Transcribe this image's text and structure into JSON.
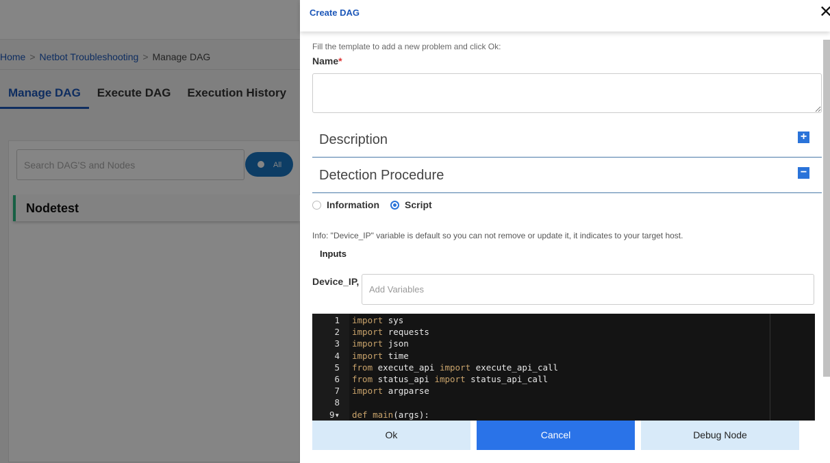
{
  "background": {
    "breadcrumb": [
      "Home",
      "Netbot Troubleshooting",
      "Manage DAG"
    ],
    "tabs": [
      "Manage DAG",
      "Execute DAG",
      "Execution History"
    ],
    "search_placeholder": "Search DAG'S and Nodes",
    "toggle_label": "All",
    "node_name": "Nodetest"
  },
  "dialog": {
    "title": "Create DAG",
    "hint": "Fill the template to add a new problem and click Ok:",
    "name_label": "Name",
    "name_value": "",
    "required_mark": "*",
    "sections": [
      {
        "label": "Description",
        "state": "collapsed",
        "icon": "+"
      },
      {
        "label": "Detection Procedure",
        "state": "expanded",
        "icon": "−"
      }
    ],
    "radio_options": [
      {
        "label": "Information",
        "selected": false
      },
      {
        "label": "Script",
        "selected": true
      }
    ],
    "info": "Info: \"Device_IP\" variable is default so you can not remove or update it, it indicates to your target host.",
    "inputs_label": "Inputs",
    "device_label": "Device_IP,",
    "variables_placeholder": "Add Variables",
    "code_lines": [
      [
        [
          "kw",
          "import"
        ],
        [
          "",
          "sys"
        ]
      ],
      [
        [
          "kw",
          "import"
        ],
        [
          "",
          "requests"
        ]
      ],
      [
        [
          "kw",
          "import"
        ],
        [
          "",
          "json"
        ]
      ],
      [
        [
          "kw",
          "import"
        ],
        [
          "",
          "time"
        ]
      ],
      [
        [
          "kw",
          "from"
        ],
        [
          "",
          "execute_api"
        ],
        [
          "kw",
          "import"
        ],
        [
          "",
          "execute_api_call"
        ]
      ],
      [
        [
          "kw",
          "from"
        ],
        [
          "",
          "status_api"
        ],
        [
          "kw",
          "import"
        ],
        [
          "",
          "status_api_call"
        ]
      ],
      [
        [
          "kw",
          "import"
        ],
        [
          "",
          "argparse"
        ]
      ],
      [],
      [
        [
          "kw",
          "def"
        ],
        [
          "kw",
          "main"
        ],
        [
          "",
          "(args):"
        ]
      ]
    ],
    "buttons": [
      "Ok",
      "Cancel",
      "Debug Node"
    ],
    "colors": {
      "accent": "#2a73e8",
      "keyword": "#c9a36b",
      "editor_bg": "#141414"
    }
  }
}
